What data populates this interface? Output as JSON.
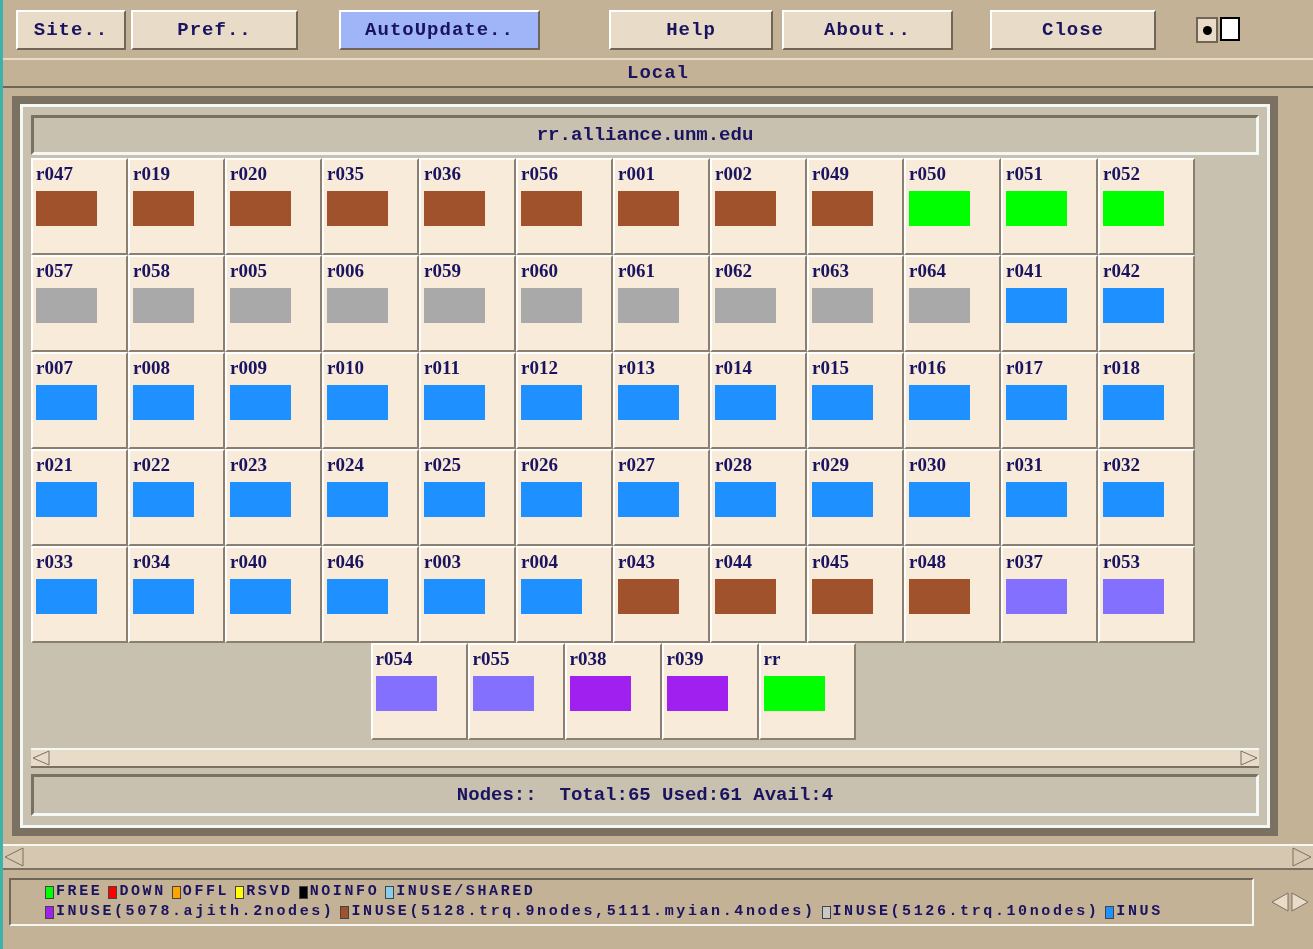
{
  "toolbar": [
    {
      "label": "Site..",
      "selected": false
    },
    {
      "label": "Pref..",
      "selected": false
    },
    {
      "label": "AutoUpdate..",
      "selected": true
    },
    {
      "label": "Help",
      "selected": false
    },
    {
      "label": "About..",
      "selected": false
    },
    {
      "label": "Close",
      "selected": false
    }
  ],
  "view_toggles": [
    {
      "selected": true
    },
    {
      "selected": false
    }
  ],
  "section_title": "Local",
  "server": {
    "title": "rr.alliance.unm.edu",
    "nodes": [
      {
        "name": "r047",
        "color": "#a0522d"
      },
      {
        "name": "r019",
        "color": "#a0522d"
      },
      {
        "name": "r020",
        "color": "#a0522d"
      },
      {
        "name": "r035",
        "color": "#a0522d"
      },
      {
        "name": "r036",
        "color": "#a0522d"
      },
      {
        "name": "r056",
        "color": "#a0522d"
      },
      {
        "name": "r001",
        "color": "#a0522d"
      },
      {
        "name": "r002",
        "color": "#a0522d"
      },
      {
        "name": "r049",
        "color": "#a0522d"
      },
      {
        "name": "r050",
        "color": "#00ff00"
      },
      {
        "name": "r051",
        "color": "#00ff00"
      },
      {
        "name": "r052",
        "color": "#00ff00"
      },
      {
        "name": "r057",
        "color": "#a9a9a9"
      },
      {
        "name": "r058",
        "color": "#a9a9a9"
      },
      {
        "name": "r005",
        "color": "#a9a9a9"
      },
      {
        "name": "r006",
        "color": "#a9a9a9"
      },
      {
        "name": "r059",
        "color": "#a9a9a9"
      },
      {
        "name": "r060",
        "color": "#a9a9a9"
      },
      {
        "name": "r061",
        "color": "#a9a9a9"
      },
      {
        "name": "r062",
        "color": "#a9a9a9"
      },
      {
        "name": "r063",
        "color": "#a9a9a9"
      },
      {
        "name": "r064",
        "color": "#a9a9a9"
      },
      {
        "name": "r041",
        "color": "#1e90ff"
      },
      {
        "name": "r042",
        "color": "#1e90ff"
      },
      {
        "name": "r007",
        "color": "#1e90ff"
      },
      {
        "name": "r008",
        "color": "#1e90ff"
      },
      {
        "name": "r009",
        "color": "#1e90ff"
      },
      {
        "name": "r010",
        "color": "#1e90ff"
      },
      {
        "name": "r011",
        "color": "#1e90ff"
      },
      {
        "name": "r012",
        "color": "#1e90ff"
      },
      {
        "name": "r013",
        "color": "#1e90ff"
      },
      {
        "name": "r014",
        "color": "#1e90ff"
      },
      {
        "name": "r015",
        "color": "#1e90ff"
      },
      {
        "name": "r016",
        "color": "#1e90ff"
      },
      {
        "name": "r017",
        "color": "#1e90ff"
      },
      {
        "name": "r018",
        "color": "#1e90ff"
      },
      {
        "name": "r021",
        "color": "#1e90ff"
      },
      {
        "name": "r022",
        "color": "#1e90ff"
      },
      {
        "name": "r023",
        "color": "#1e90ff"
      },
      {
        "name": "r024",
        "color": "#1e90ff"
      },
      {
        "name": "r025",
        "color": "#1e90ff"
      },
      {
        "name": "r026",
        "color": "#1e90ff"
      },
      {
        "name": "r027",
        "color": "#1e90ff"
      },
      {
        "name": "r028",
        "color": "#1e90ff"
      },
      {
        "name": "r029",
        "color": "#1e90ff"
      },
      {
        "name": "r030",
        "color": "#1e90ff"
      },
      {
        "name": "r031",
        "color": "#1e90ff"
      },
      {
        "name": "r032",
        "color": "#1e90ff"
      },
      {
        "name": "r033",
        "color": "#1e90ff"
      },
      {
        "name": "r034",
        "color": "#1e90ff"
      },
      {
        "name": "r040",
        "color": "#1e90ff"
      },
      {
        "name": "r046",
        "color": "#1e90ff"
      },
      {
        "name": "r003",
        "color": "#1e90ff"
      },
      {
        "name": "r004",
        "color": "#1e90ff"
      },
      {
        "name": "r043",
        "color": "#a0522d"
      },
      {
        "name": "r044",
        "color": "#a0522d"
      },
      {
        "name": "r045",
        "color": "#a0522d"
      },
      {
        "name": "r048",
        "color": "#a0522d"
      },
      {
        "name": "r037",
        "color": "#8470ff"
      },
      {
        "name": "r053",
        "color": "#8470ff"
      },
      {
        "name": "r054",
        "color": "#8470ff"
      },
      {
        "name": "r055",
        "color": "#8470ff"
      },
      {
        "name": "r038",
        "color": "#a020f0"
      },
      {
        "name": "r039",
        "color": "#a020f0"
      },
      {
        "name": "rr",
        "color": "#00ff00"
      }
    ],
    "status": "Nodes::  Total:65 Used:61 Avail:4"
  },
  "legend": [
    [
      {
        "label": "FREE",
        "color": "#00ff00"
      },
      {
        "label": "DOWN",
        "color": "#ff0000"
      },
      {
        "label": "OFFL",
        "color": "#ffa500"
      },
      {
        "label": "RSVD",
        "color": "#ffff00"
      },
      {
        "label": "NOINFO",
        "color": "#000000"
      },
      {
        "label": "INUSE/SHARED",
        "color": "#87ceeb"
      }
    ],
    [
      {
        "label": "INUSE(5078.ajith.2nodes)",
        "color": "#a020f0"
      },
      {
        "label": "INUSE(5128.trq.9nodes,5111.myian.4nodes)",
        "color": "#a0522d"
      },
      {
        "label": "INUSE(5126.trq.10nodes)",
        "color": "#c8c8c8"
      },
      {
        "label": "INUS",
        "color": "#1e90ff"
      }
    ]
  ]
}
